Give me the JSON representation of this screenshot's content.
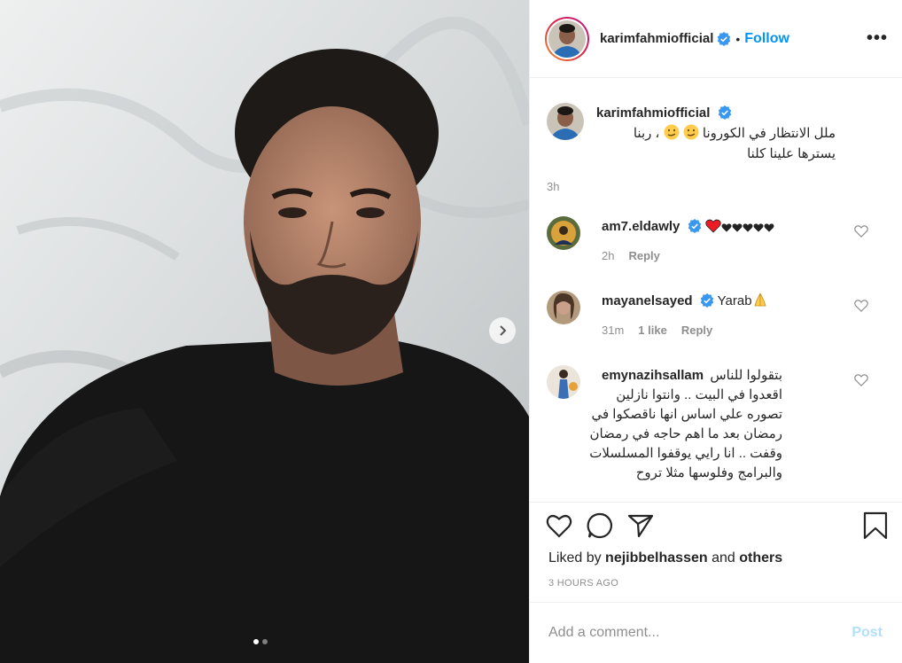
{
  "post": {
    "author": "karimfahmiofficial",
    "follow_label": "Follow",
    "separator": "•",
    "more_label": "•••",
    "caption_line1": "ملل الانتظار في الكورونا",
    "caption_line1_suffix": "، ربنا",
    "caption_line2": "يسترها علينا كلنا",
    "caption_time": "3h",
    "carousel": {
      "count": 2,
      "active_index": 0
    }
  },
  "comments": [
    {
      "user": "am7.eldawly",
      "verified": true,
      "time": "2h",
      "likes": "",
      "reply": "Reply",
      "avatar_color": "#d9a23a"
    },
    {
      "user": "mayanelsayed",
      "verified": true,
      "text": "Yarab",
      "time": "31m",
      "likes": "1 like",
      "reply": "Reply",
      "avatar_color": "#6a5a4a"
    },
    {
      "user": "emynazihsallam",
      "verified": false,
      "lines": [
        "بتقولوا للناس",
        "اقعدوا في البيت .. وانتوا نازلين",
        "تصوره علي اساس انها ناقصكوا في",
        "رمضان بعد ما اهم حاجه في رمضان",
        "وقفت .. انا رايي يوقفوا المسلسلات",
        "والبرامج وفلوسها مثلا تروح"
      ],
      "avatar_color": "#3a6fb8"
    }
  ],
  "likes": {
    "prefix": "Liked by",
    "user": "nejibbelhassen",
    "and": "and",
    "others": "others"
  },
  "timestamp": "3 HOURS AGO",
  "add_comment": {
    "placeholder": "Add a comment...",
    "post_label": "Post"
  },
  "colors": {
    "accent": "#0095f6",
    "verified": "#3897f0",
    "muted": "#8e8e8e",
    "heart_red": "#ed4956"
  }
}
